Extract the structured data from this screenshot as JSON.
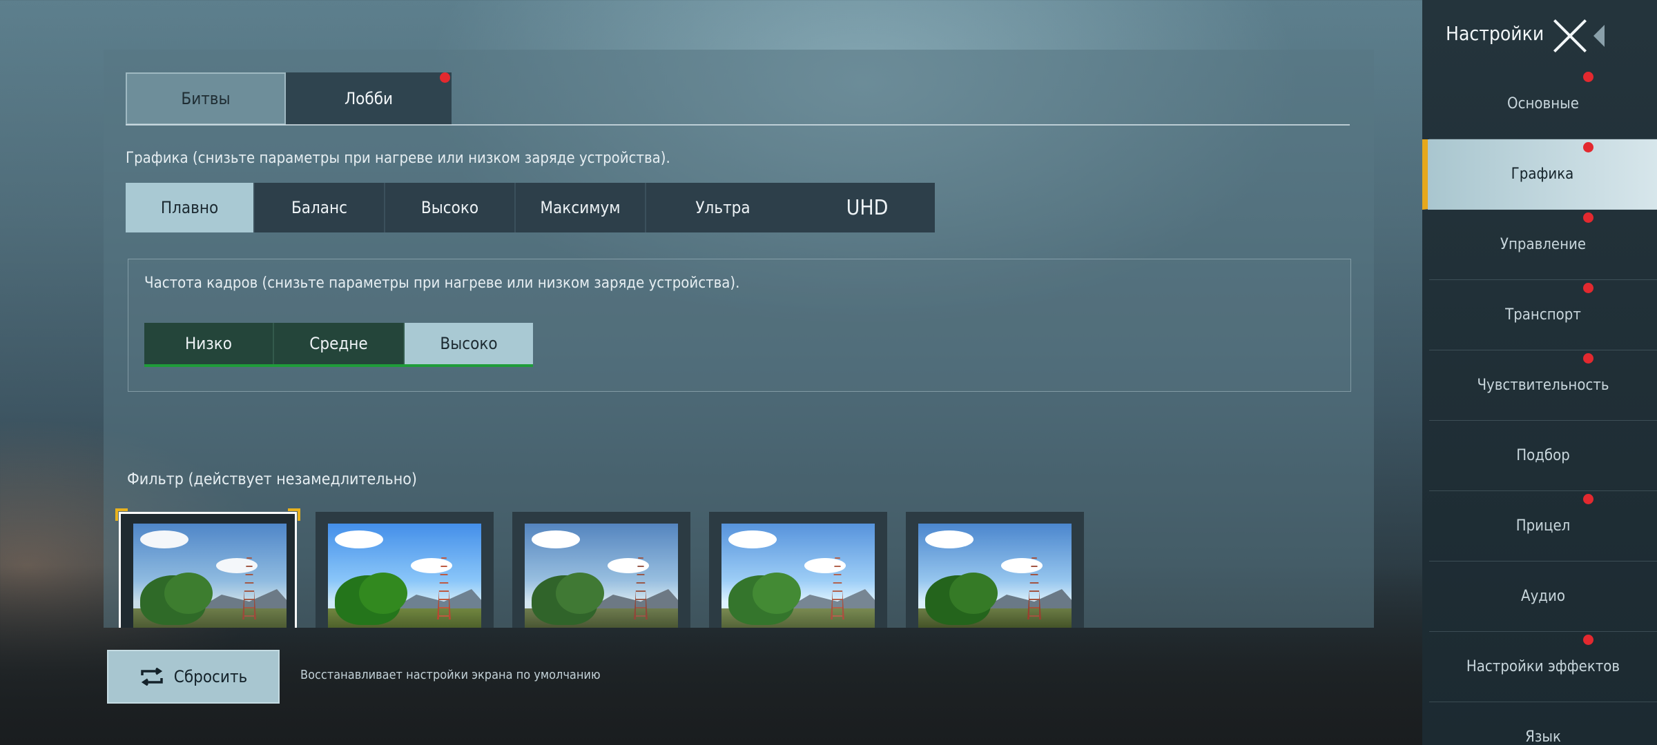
{
  "tabs": [
    {
      "label": "Битвы",
      "active": true
    },
    {
      "label": "Лобби",
      "active": false,
      "notify": true
    }
  ],
  "graphics": {
    "heading": "Графика (снизьте параметры при нагреве или низком заряде устройства).",
    "options": [
      "Плавно",
      "Баланс",
      "Высоко",
      "Максимум",
      "Ультра",
      "UHD"
    ],
    "selected": "Плавно"
  },
  "fps": {
    "heading": "Частота кадров (снизьте параметры при нагреве или низком заряде устройства).",
    "options": [
      "Низко",
      "Средне",
      "Высоко"
    ],
    "selected": "Высоко"
  },
  "filter": {
    "heading": "Фильтр (действует незамедлительно)",
    "selected_index": 0,
    "count": 5
  },
  "reset": {
    "label": "Сбросить",
    "description": "Восстанавливает настройки экрана по умолчанию"
  },
  "sidebar": {
    "title": "Настройки",
    "items": [
      {
        "label": "Основные",
        "notify": true
      },
      {
        "label": "Графика",
        "notify": true,
        "active": true
      },
      {
        "label": "Управление",
        "notify": true
      },
      {
        "label": "Транспорт",
        "notify": true
      },
      {
        "label": "Чувствительность",
        "notify": true
      },
      {
        "label": "Подбор",
        "notify": false
      },
      {
        "label": "Прицел",
        "notify": true
      },
      {
        "label": "Аудио",
        "notify": false
      },
      {
        "label": "Настройки эффектов",
        "notify": true
      },
      {
        "label": "Язык",
        "notify": false
      }
    ]
  },
  "colors": {
    "accent": "#e6a81c",
    "notify": "#e3292f",
    "selected_button": "#a9c9d3",
    "fps_underline": "#1f9c3a"
  }
}
